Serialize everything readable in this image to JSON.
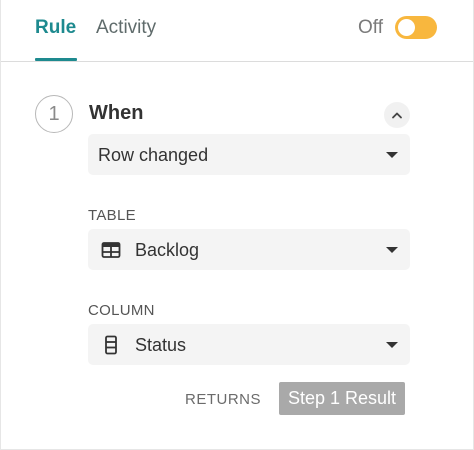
{
  "tabs": [
    {
      "label": "Rule",
      "active": true
    },
    {
      "label": "Activity",
      "active": false
    }
  ],
  "toggle": {
    "label": "Off",
    "on": false,
    "color": "#f8b73e"
  },
  "accent_color": "#1e8a8f",
  "step": {
    "number": "1",
    "title": "When",
    "trigger": {
      "value": "Row changed"
    },
    "table": {
      "label": "TABLE",
      "value": "Backlog",
      "icon": "table-grid-icon"
    },
    "column": {
      "label": "COLUMN",
      "value": "Status",
      "icon": "column-stack-icon"
    },
    "returns": {
      "label": "RETURNS",
      "value": "Step 1 Result"
    }
  }
}
